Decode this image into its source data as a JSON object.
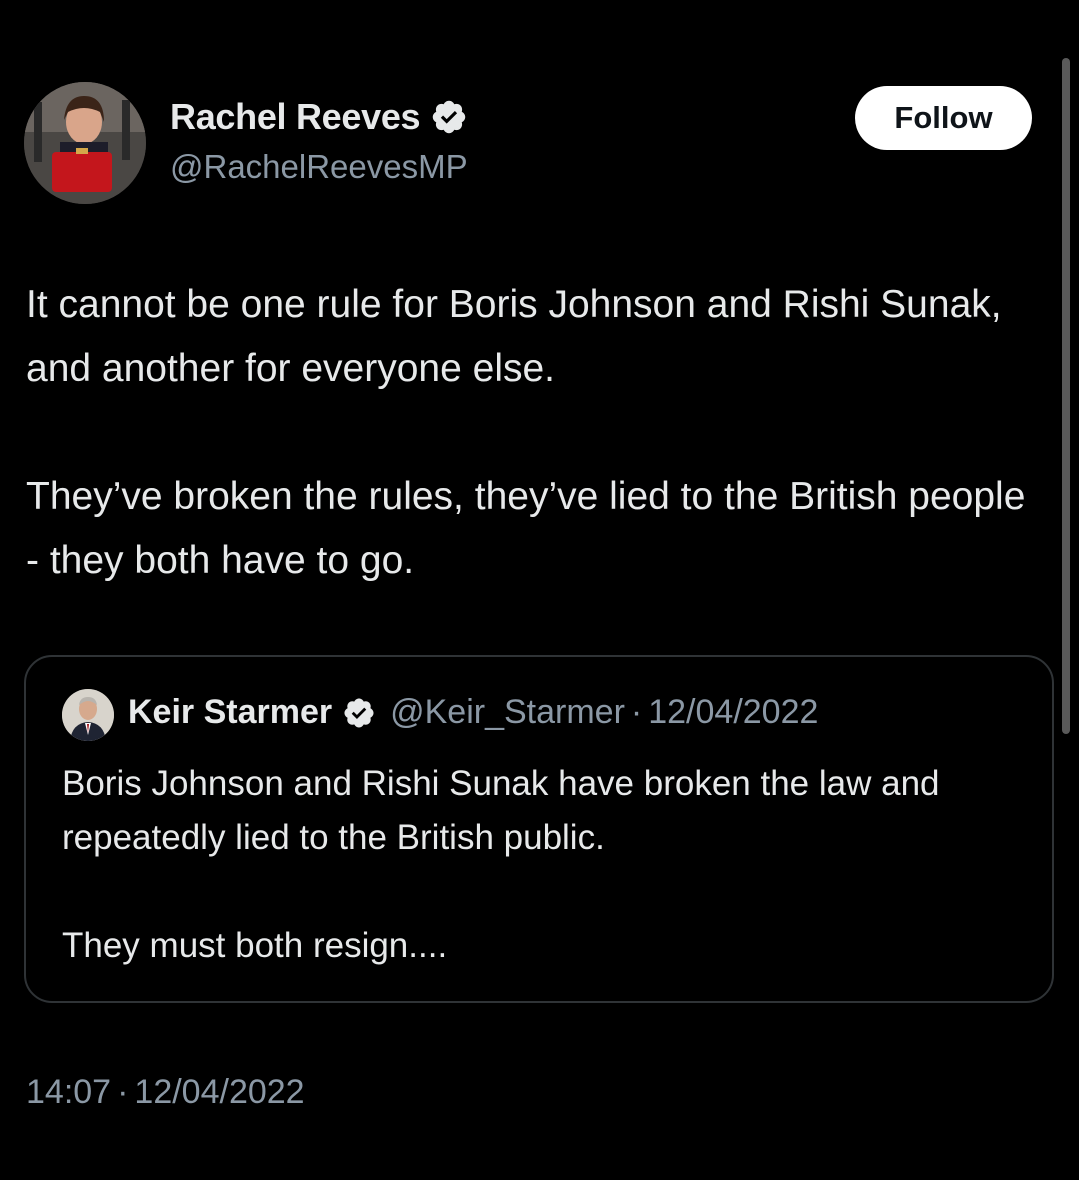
{
  "author": {
    "display_name": "Rachel Reeves",
    "handle": "@RachelReevesMP",
    "verified": true
  },
  "follow_button": {
    "label": "Follow"
  },
  "tweet": {
    "text": "It cannot be one rule for Boris Johnson and Rishi Sunak, and another for everyone else.\n\nThey’ve broken the rules, they’ve lied to the British people - they both have to go."
  },
  "quoted_tweet": {
    "display_name": "Keir Starmer",
    "handle": "@Keir_Starmer",
    "separator": "·",
    "date": "12/04/2022",
    "verified": true,
    "text": "Boris Johnson and Rishi Sunak have broken the law and repeatedly lied to the British public.\n\nThey must both resign...."
  },
  "footer": {
    "time": "14:07",
    "separator": "·",
    "date": "12/04/2022"
  },
  "colors": {
    "background": "#000000",
    "text_primary": "#e7e9ea",
    "text_secondary": "#8b98a5",
    "verified_badge": "#e7e9ea",
    "border": "#2f3336"
  },
  "icons": {
    "verified": "verified-badge-icon"
  }
}
